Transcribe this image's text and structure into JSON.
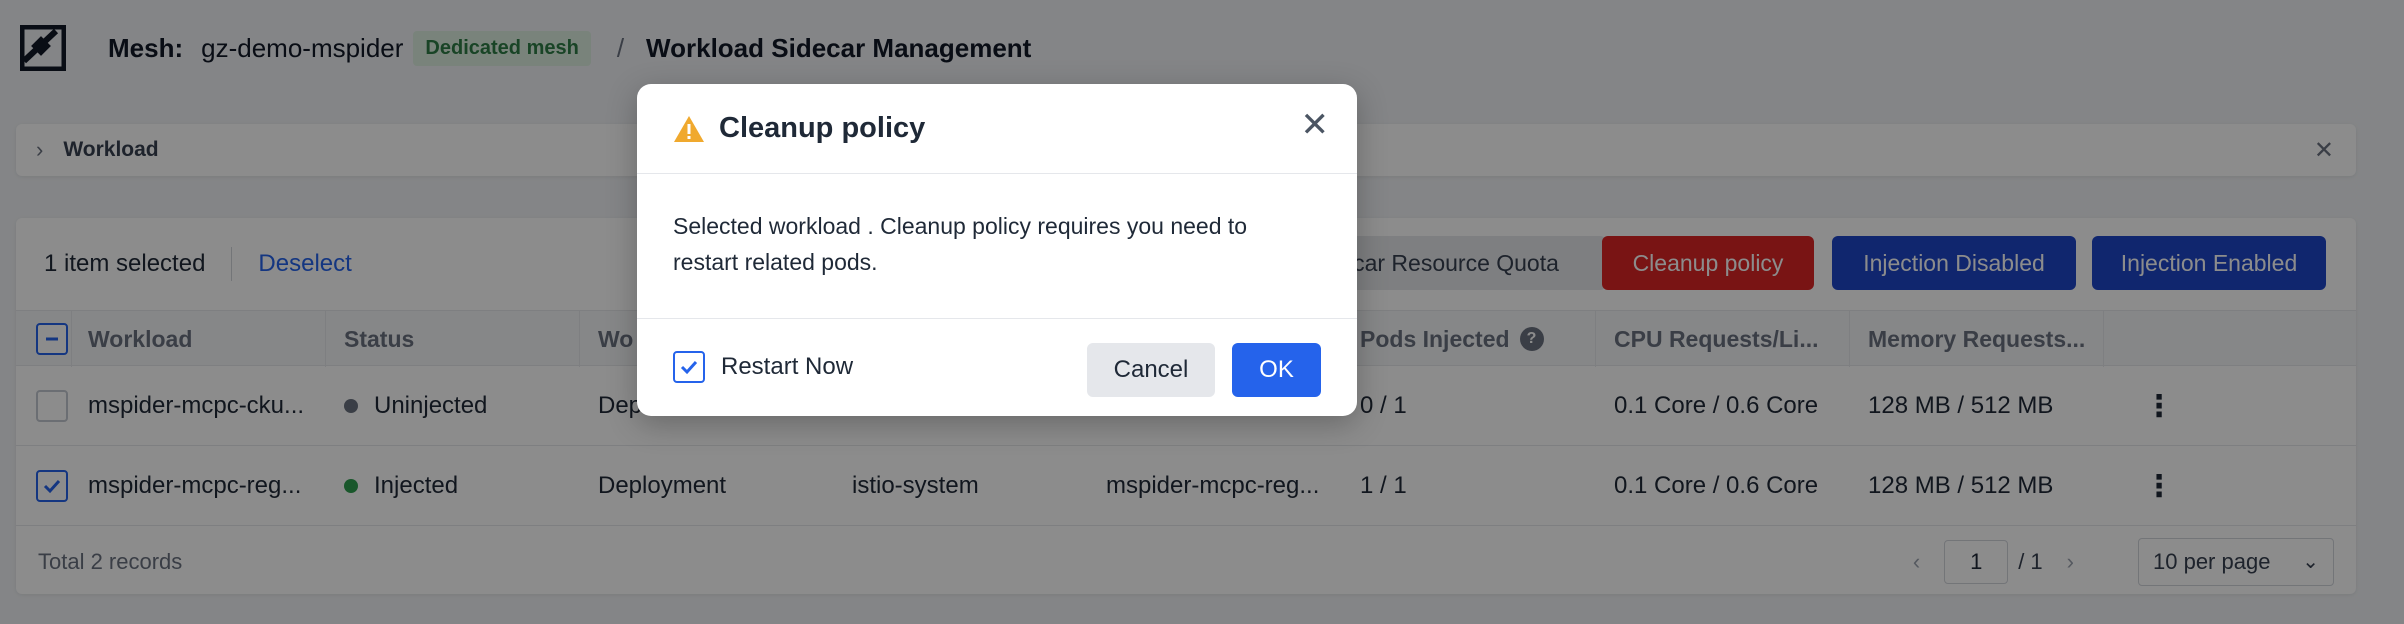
{
  "header": {
    "mesh_label": "Mesh:",
    "mesh_name": "gz-demo-mspider",
    "badge": "Dedicated mesh",
    "separator": "/",
    "title": "Workload Sidecar Management"
  },
  "filter_bar": {
    "label": "Workload"
  },
  "toolbar": {
    "selected_text": "1 item selected",
    "deselect": "Deselect",
    "quota_button": "car Resource Quota",
    "cleanup_button": "Cleanup policy",
    "disabled_button": "Injection Disabled",
    "enabled_button": "Injection Enabled"
  },
  "table": {
    "columns": [
      "Workload",
      "Status",
      "Wo",
      "",
      "",
      "Pods Injected",
      "CPU Requests/Li...",
      "Memory Requests..."
    ],
    "rows": [
      {
        "workload": "mspider-mcpc-cku...",
        "status": "Uninjected",
        "status_color": "#6b7280",
        "type": "Depl",
        "namespace": "",
        "name": "",
        "pods": "0 / 1",
        "cpu": "0.1 Core / 0.6 Core",
        "memory": "128 MB / 512 MB",
        "checked": false
      },
      {
        "workload": "mspider-mcpc-reg...",
        "status": "Injected",
        "status_color": "#2e9e4f",
        "type": "Deployment",
        "namespace": "istio-system",
        "name": "mspider-mcpc-reg...",
        "pods": "1 / 1",
        "cpu": "0.1 Core / 0.6 Core",
        "memory": "128 MB / 512 MB",
        "checked": true
      }
    ]
  },
  "footer": {
    "total": "Total 2 records",
    "page": "1",
    "page_total": "/ 1",
    "per_page": "10 per page"
  },
  "modal": {
    "title": "Cleanup policy",
    "body_line1": "Selected workload . Cleanup policy requires you need to",
    "body_line2": "restart related pods.",
    "checkbox_label": "Restart Now",
    "cancel": "Cancel",
    "ok": "OK"
  },
  "icons": {
    "close": "close-icon",
    "warning": "warning-icon",
    "kebab": "more-vertical-icon",
    "help": "help-icon"
  }
}
